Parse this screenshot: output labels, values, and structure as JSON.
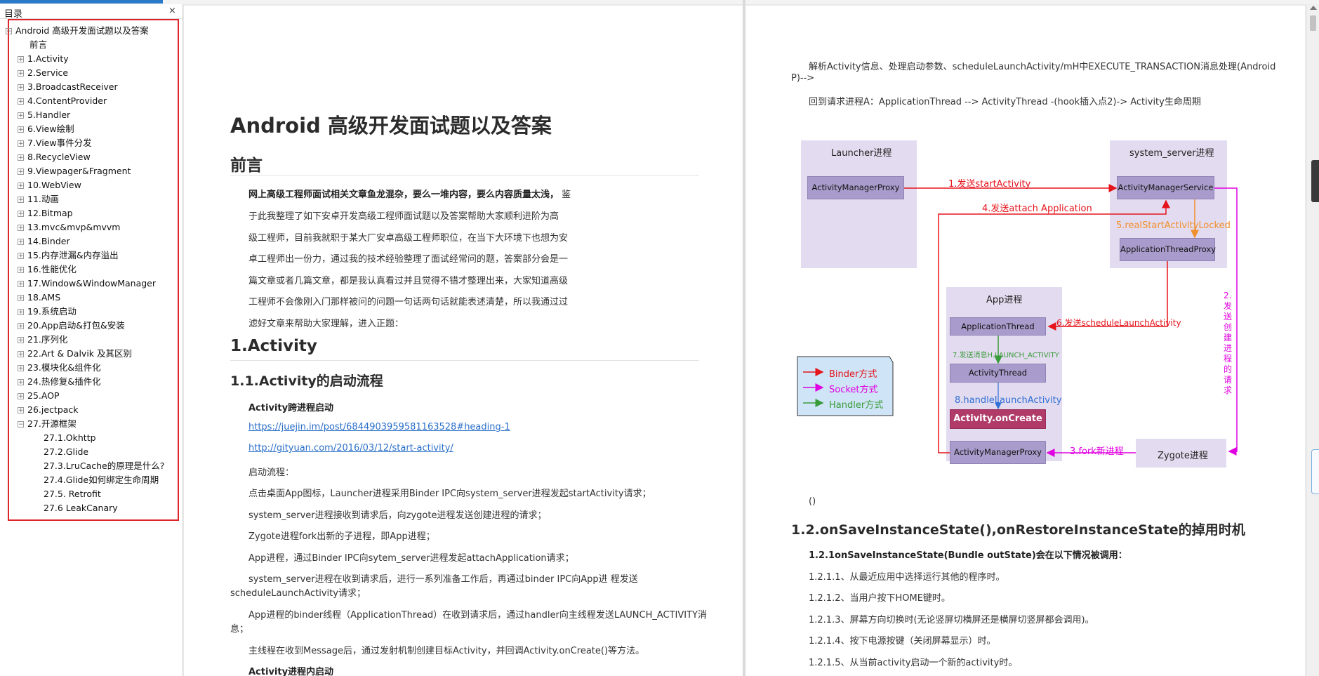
{
  "sidebar": {
    "title": "目录",
    "close": "×",
    "toc": [
      {
        "label": "Android 高级开发面试题以及答案",
        "level": 0,
        "expand": "−"
      },
      {
        "label": "前言",
        "level": 1,
        "expand": ""
      },
      {
        "label": "1.Activity",
        "level": 1,
        "expand": "+"
      },
      {
        "label": "2.Service",
        "level": 1,
        "expand": "+"
      },
      {
        "label": "3.BroadcastReceiver",
        "level": 1,
        "expand": "+"
      },
      {
        "label": "4.ContentProvider",
        "level": 1,
        "expand": "+"
      },
      {
        "label": "5.Handler",
        "level": 1,
        "expand": "+"
      },
      {
        "label": "6.View绘制",
        "level": 1,
        "expand": "+"
      },
      {
        "label": "7.View事件分发",
        "level": 1,
        "expand": "+"
      },
      {
        "label": "8.RecycleView",
        "level": 1,
        "expand": "+"
      },
      {
        "label": "9.Viewpager&Fragment",
        "level": 1,
        "expand": "+"
      },
      {
        "label": "10.WebView",
        "level": 1,
        "expand": "+"
      },
      {
        "label": "11.动画",
        "level": 1,
        "expand": "+"
      },
      {
        "label": "12.Bitmap",
        "level": 1,
        "expand": "+"
      },
      {
        "label": "13.mvc&mvp&mvvm",
        "level": 1,
        "expand": "+"
      },
      {
        "label": "14.Binder",
        "level": 1,
        "expand": "+"
      },
      {
        "label": "15.内存泄漏&内存溢出",
        "level": 1,
        "expand": "+"
      },
      {
        "label": "16.性能优化",
        "level": 1,
        "expand": "+"
      },
      {
        "label": "17.Window&WindowManager",
        "level": 1,
        "expand": "+"
      },
      {
        "label": "18.AMS",
        "level": 1,
        "expand": "+"
      },
      {
        "label": "19.系统启动",
        "level": 1,
        "expand": "+"
      },
      {
        "label": "20.App启动&打包&安装",
        "level": 1,
        "expand": "+"
      },
      {
        "label": "21.序列化",
        "level": 1,
        "expand": "+"
      },
      {
        "label": "22.Art & Dalvik 及其区别",
        "level": 1,
        "expand": "+"
      },
      {
        "label": "23.模块化&组件化",
        "level": 1,
        "expand": "+"
      },
      {
        "label": "24.热修复&插件化",
        "level": 1,
        "expand": "+"
      },
      {
        "label": "25.AOP",
        "level": 1,
        "expand": "+"
      },
      {
        "label": "26.jectpack",
        "level": 1,
        "expand": "+"
      },
      {
        "label": "27.开源框架",
        "level": 1,
        "expand": "−"
      },
      {
        "label": "27.1.Okhttp",
        "level": 2,
        "expand": ""
      },
      {
        "label": "27.2.Glide",
        "level": 2,
        "expand": ""
      },
      {
        "label": "27.3.LruCache的原理是什么?",
        "level": 2,
        "expand": ""
      },
      {
        "label": "27.4.Glide如何绑定生命周期",
        "level": 2,
        "expand": ""
      },
      {
        "label": "27.5. Retrofit",
        "level": 2,
        "expand": ""
      },
      {
        "label": "27.6 LeakCanary",
        "level": 2,
        "expand": ""
      }
    ]
  },
  "left": {
    "title": "Android 高级开发面试题以及答案",
    "h_preface": "前言",
    "preface_bold": "网上高级工程师面试相关文章鱼龙混杂，要么一堆内容，要么内容质量太浅，",
    "preface_lines": [
      "鉴",
      "于此我整理了如下安卓开发高级工程师面试题以及答案帮助大家顺利进阶为高",
      "级工程师，目前我就职于某大厂安卓高级工程师职位，在当下大环境下也想为安",
      "卓工程师出一份力，通过我的技术经验整理了面试经常问的题，答案部分会是一",
      "篇文章或者几篇文章，都是我认真看过并且觉得不错才整理出来，大家知道高级",
      "工程师不会像刚入门那样被问的问题一句话两句话就能表述清楚，所以我通过过",
      "滤好文章来帮助大家理解，进入正题："
    ],
    "h_activity": "1.Activity",
    "h_activity_start": "1.1.Activity的启动流程",
    "cross_process": "Activity跨进程启动",
    "link1": "https://juejin.im/post/6844903959581163528#heading-1",
    "link2": "http://gityuan.com/2016/03/12/start-activity/",
    "flow_title": "启动流程：",
    "steps": [
      "点击桌面App图标，Launcher进程采用Binder IPC向system_server进程发起startActivity请求；",
      "system_server进程接收到请求后，向zygote进程发送创建进程的请求；",
      "Zygote进程fork出新的子进程，即App进程；",
      "App进程，通过Binder IPC向sytem_server进程发起attachApplication请求；"
    ],
    "step5a": "system_server进程在收到请求后，进行一系列准备工作后，再通过binder IPC向App进 程发送",
    "step5b": "scheduleLaunchActivity请求；",
    "step6a": "App进程的binder线程（ApplicationThread）在收到请求后，通过handler向主线程发送LAUNCH_ACTIVITY消",
    "step6b": "息；",
    "step7": "主线程在收到Message后，通过发射机制创建目标Activity，并回调Activity.onCreate()等方法。",
    "in_process": "Activity进程内启动"
  },
  "right": {
    "parse_a": "解析Activity信息、处理启动参数、scheduleLaunchActivity/mH中EXECUTE_TRANSACTION消息处理(Android",
    "parse_b": "P)-->",
    "back_line": "回到请求进程A：ApplicationThread --> ActivityThread -(hook插入点2)-> Activity生命周期",
    "paren": "()",
    "h_save": "1.2.onSaveInstanceState(),onRestoreInstanceState的掉用时机",
    "save_bold": "1.2.1onSaveInstanceState(Bundle outState)会在以下情况被调用：",
    "save_items": [
      "1.2.1.1、从最近应用中选择运行其他的程序时。",
      "1.2.1.2、当用户按下HOME键时。",
      "1.2.1.3、屏幕方向切换时(无论竖屏切横屏还是横屏切竖屏都会调用)。",
      "1.2.1.4、按下电源按键（关闭屏幕显示）时。",
      "1.2.1.5、从当前activity启动一个新的activity时。"
    ]
  },
  "diagram": {
    "launcher": "Launcher进程",
    "system_server": "system_server进程",
    "app": "App进程",
    "amp1": "ActivityManagerProxy",
    "ams": "ActivityManagerService",
    "atp": "ApplicationThreadProxy",
    "at": "ApplicationThread",
    "athread": "ActivityThread",
    "oncreate": "Activity.onCreate",
    "amp2": "ActivityManagerProxy",
    "zygote": "Zygote进程",
    "l1": "1.发送startActivity",
    "l2": "2.发送创建进程的请求",
    "l3": "3.fork新进程",
    "l4": "4.发送attach Application",
    "l5": "5.realStartActivityLocked",
    "l6": "6.发送scheduleLaunchActivity",
    "l7": "7.发送消息H.LAUNCH_ACTIVITY",
    "l8": "8.handleLaunchActivity",
    "legend": {
      "binder": "Binder方式",
      "socket": "Socket方式",
      "handler": "Handler方式"
    },
    "colors": {
      "binder": "#e5141b",
      "socket": "#e100e1",
      "handler": "#3a9b3a",
      "orange": "#f0902c",
      "blue": "#2f6fd6",
      "node": "#a99bcb",
      "box": "#e3dbef",
      "oncreate": "#b03a68"
    }
  }
}
